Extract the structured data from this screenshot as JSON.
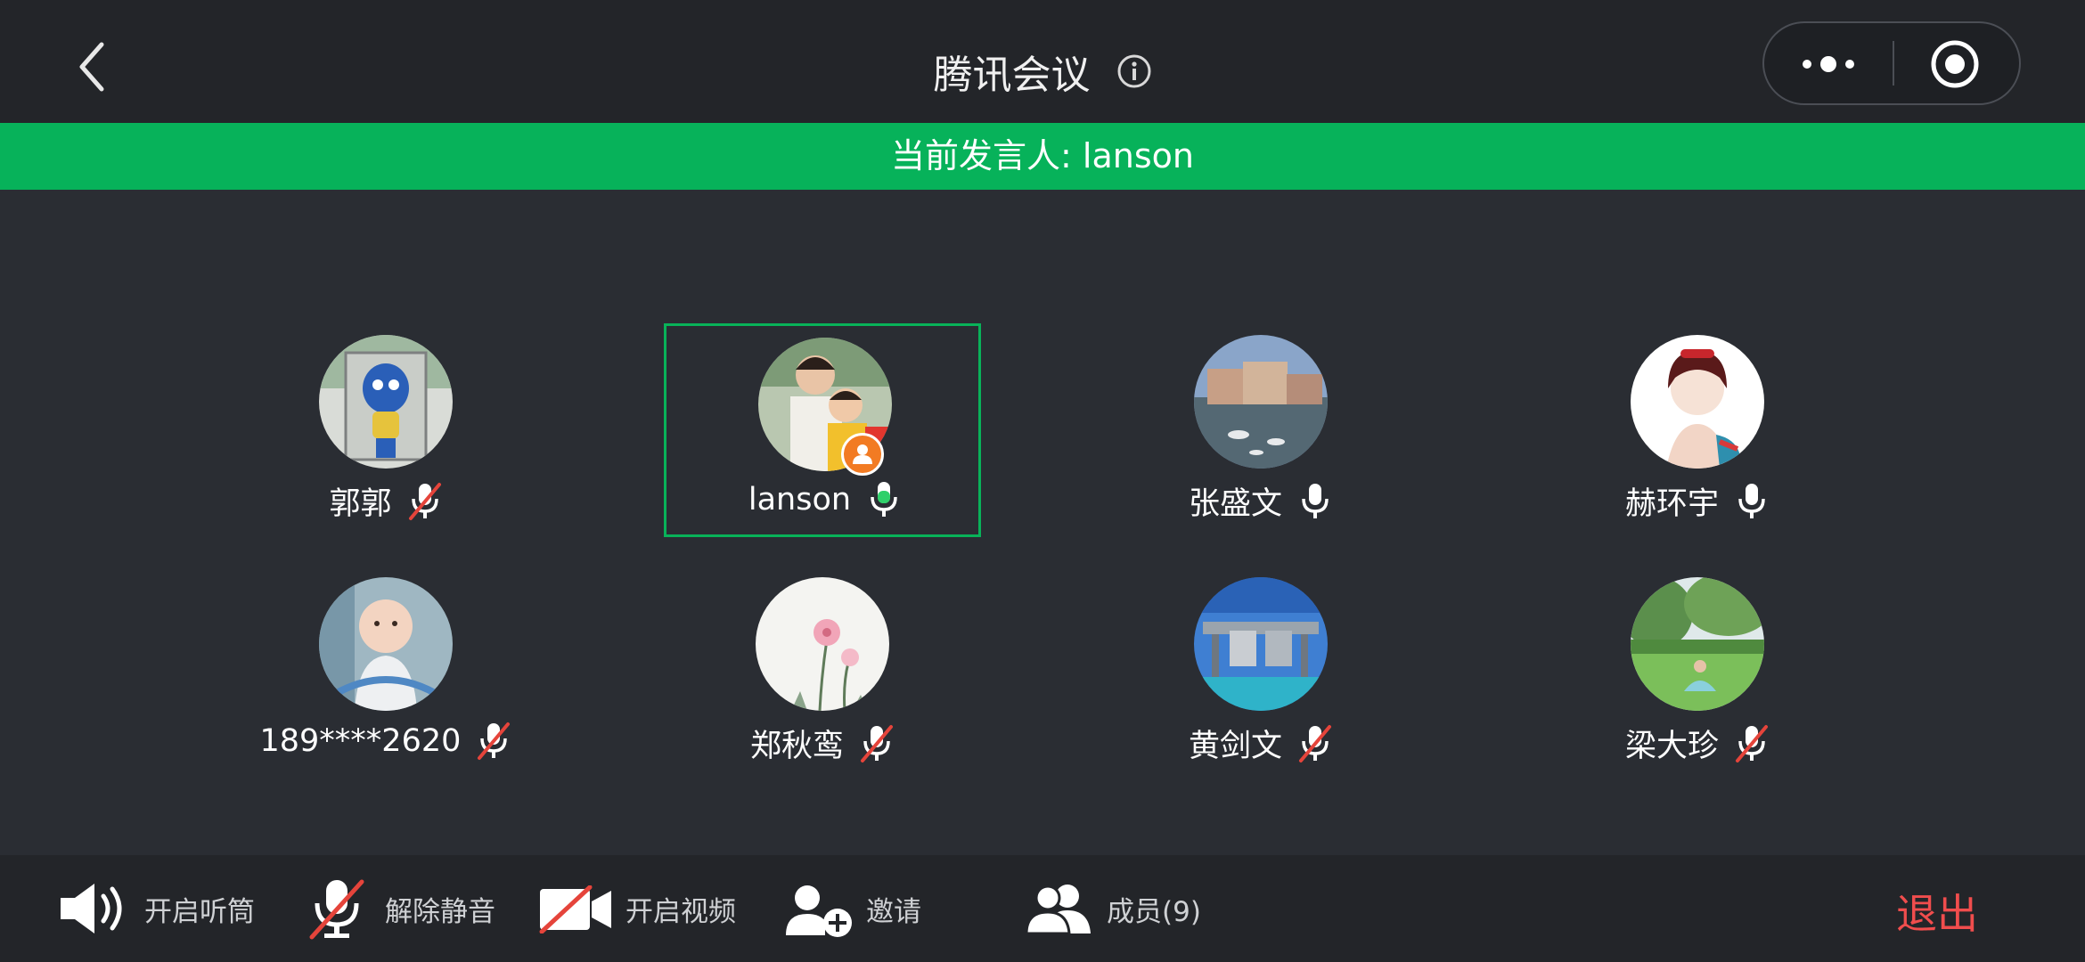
{
  "header": {
    "title": "腾讯会议",
    "back_icon": "chevron-left-icon",
    "info_icon": "info-icon",
    "capsule": {
      "more_icon": "more-dots-icon",
      "close_icon": "target-close-icon"
    }
  },
  "banner": {
    "text": "当前发言人: lanson",
    "color": "#07b25a"
  },
  "participants": [
    {
      "name": "郭郭",
      "mic": "muted",
      "active": false,
      "host": false
    },
    {
      "name": "lanson",
      "mic": "speaking",
      "active": true,
      "host": true
    },
    {
      "name": "张盛文",
      "mic": "on",
      "active": false,
      "host": false
    },
    {
      "name": "赫环宇",
      "mic": "on",
      "active": false,
      "host": false
    },
    {
      "name": "189****2620",
      "mic": "muted",
      "active": false,
      "host": false
    },
    {
      "name": "郑秋鸾",
      "mic": "muted",
      "active": false,
      "host": false
    },
    {
      "name": "黄剑文",
      "mic": "muted",
      "active": false,
      "host": false
    },
    {
      "name": "梁大珍",
      "mic": "muted",
      "active": false,
      "host": false
    }
  ],
  "toolbar": {
    "speaker_label": "开启听筒",
    "unmute_label": "解除静音",
    "video_label": "开启视频",
    "invite_label": "邀请",
    "members_label": "成员(9)",
    "exit_label": "退出"
  },
  "colors": {
    "accent_green": "#07b25a",
    "exit_red": "#f04d4d",
    "host_orange": "#f27b23",
    "mute_red": "#e5443b"
  }
}
